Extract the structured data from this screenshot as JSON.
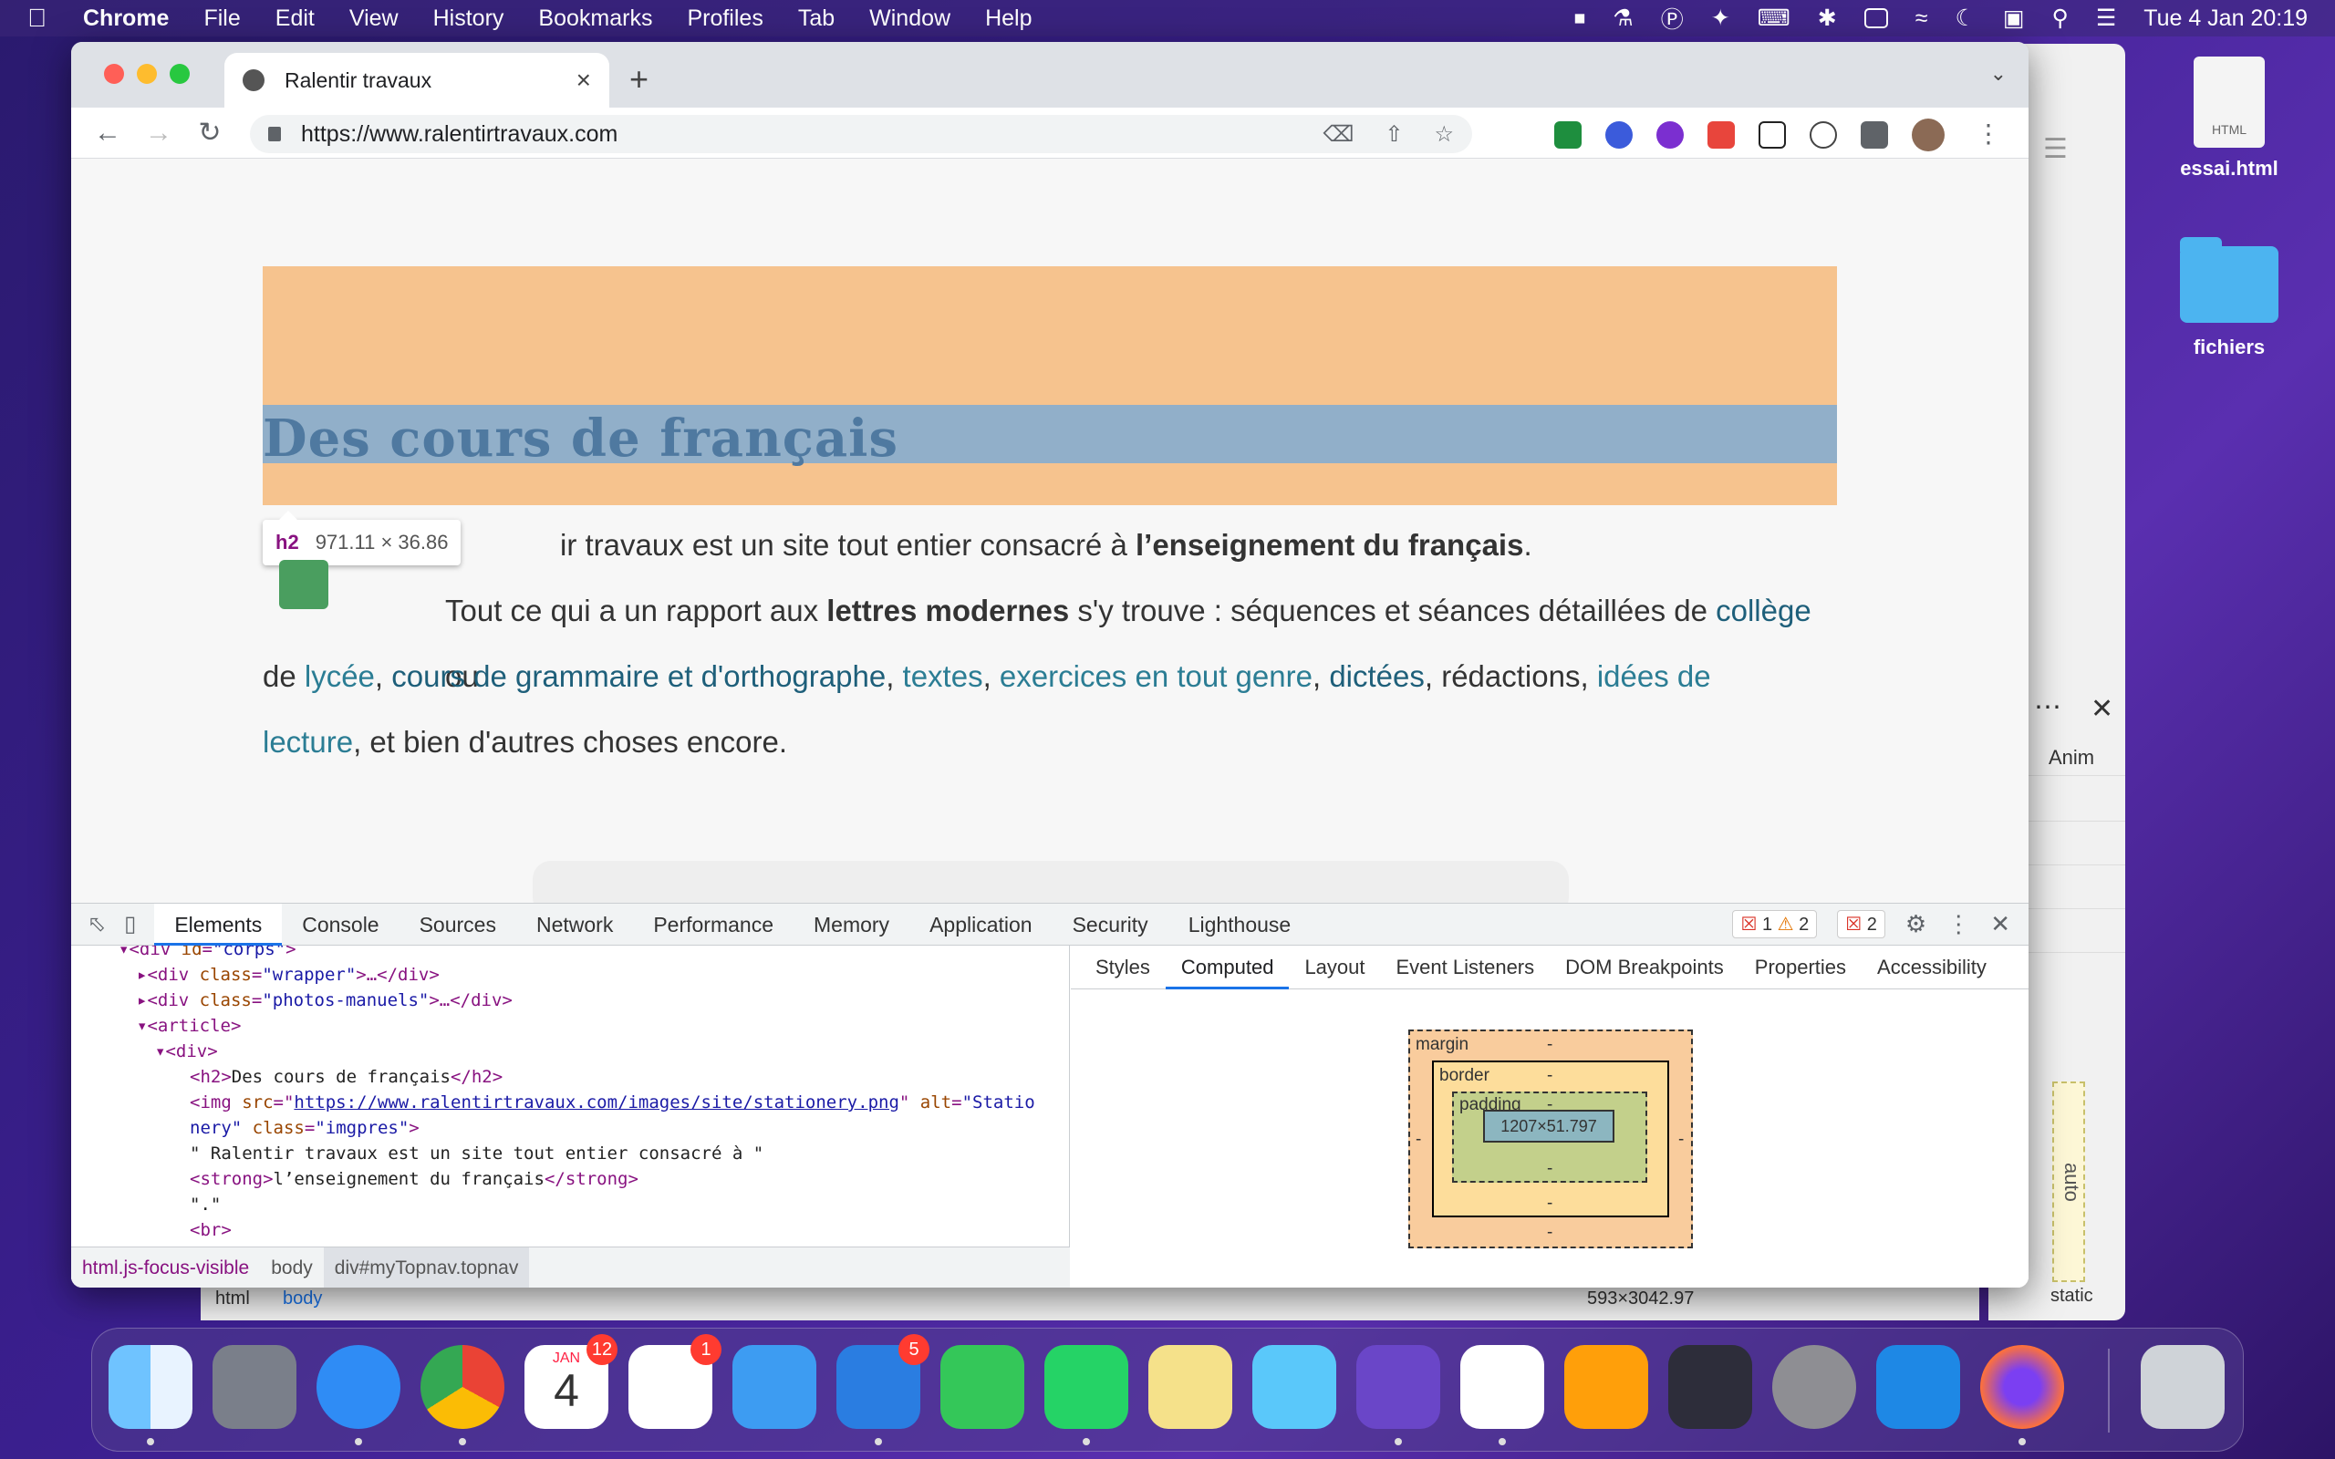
{
  "menubar": {
    "app_name": "Chrome",
    "items": [
      "File",
      "Edit",
      "View",
      "History",
      "Bookmarks",
      "Profiles",
      "Tab",
      "Window",
      "Help"
    ],
    "clock": "Tue 4 Jan  20:19"
  },
  "desktop": {
    "file_label": "essai.html",
    "file_badge": "HTML",
    "folder_label": "fichiers"
  },
  "back_window": {
    "anim_label": "Anim",
    "auto_label": "auto",
    "size_text": "593×3042.97",
    "static_text": "static",
    "crumb_html": "html",
    "crumb_body": "body"
  },
  "tab": {
    "title": "Ralentir travaux"
  },
  "omnibox": {
    "url": "https://www.ralentirtravaux.com"
  },
  "page": {
    "h2": "Des cours de français",
    "tooltip_tag": "h2",
    "tooltip_dims": "971.11 × 36.86",
    "p1_pre": "ir travaux est un site tout entier consacré à ",
    "p1_bold": "l’enseignement du français",
    "p1_post": ".",
    "p2_a": "Tout ce qui a un rapport aux ",
    "p2_b": "lettres modernes",
    "p2_c": " s'y trouve : séquences et séances détaillées de ",
    "link_college": "collège",
    "p2_d": " ou",
    "l2_de": "de ",
    "link_lycee": "lycée",
    "sep1": ", ",
    "link_grammaire": "cours de grammaire et d'orthographe",
    "sep2": ", ",
    "link_textes": "textes",
    "sep3": ", ",
    "link_exercices": "exercices en tout genre",
    "sep4": ", ",
    "link_dictees": "dictées",
    "l2_mid": ", rédactions, ",
    "link_idees": "idées de",
    "link_lecture": "lecture",
    "l3_rest": ", et bien d'autres choses encore."
  },
  "devtools": {
    "tabs": [
      "Elements",
      "Console",
      "Sources",
      "Network",
      "Performance",
      "Memory",
      "Application",
      "Security",
      "Lighthouse"
    ],
    "errors": "1",
    "warnings": "2",
    "issues": "2",
    "side_tabs": [
      "Styles",
      "Computed",
      "Layout",
      "Event Listeners",
      "DOM Breakpoints",
      "Properties",
      "Accessibility"
    ],
    "breadcrumbs": [
      "html.js-focus-visible",
      "body",
      "div#myTopnav.topnav"
    ],
    "box": {
      "margin_label": "margin",
      "border_label": "border",
      "padding_label": "padding",
      "content": "1207×51.797",
      "dash": "-"
    },
    "dom": {
      "l1_tag": "<div ",
      "l1_attr": "id",
      "l1_val": "\"corps\"",
      "l2_tag": "<div ",
      "l2_attr": "class",
      "l2_val": "\"wrapper\"",
      "l2_end": ">…</div>",
      "l3_tag": "<div ",
      "l3_attr": "class",
      "l3_val": "\"photos-manuels\"",
      "l3_end": ">…</div>",
      "l4": "<article>",
      "l5": "<div>",
      "l6_open": "<h2>",
      "l6_text": "Des cours de français",
      "l6_close": "</h2>",
      "l7_tag": "<img ",
      "l7_attr": "src",
      "l7_link": "https://www.ralentirtravaux.com/images/site/stationery.png",
      "l7_attr2": "alt",
      "l7_val2": "\"Statio",
      "l8_val": "nery\"",
      "l8_attr": "class",
      "l8_val2": "\"imgpres\"",
      "l9": "\" Ralentir travaux est un site tout entier consacré à \"",
      "l10_open": "<strong>",
      "l10_text": "l’enseignement du français",
      "l10_close": "</strong>",
      "l11": "\".\"",
      "l12": "<br>"
    }
  },
  "dock": {
    "calendar_month": "JAN",
    "calendar_day": "4",
    "calendar_badge": "12",
    "reminders_badge": "1",
    "spark_badge": "5"
  }
}
